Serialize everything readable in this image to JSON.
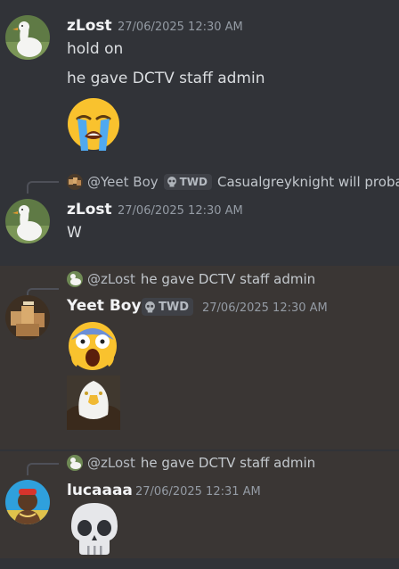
{
  "messages": [
    {
      "author": "zLost",
      "timestamp": "27/06/2025 12:30 AM",
      "lines": [
        "hold on",
        "he gave DCTV staff admin"
      ],
      "emoji": "loudly-crying-face"
    },
    {
      "reply": {
        "user": "@Yeet Boy",
        "tag": "TWD",
        "text": "Casualgreyknight will proba"
      },
      "author": "zLost",
      "timestamp": "27/06/2025 12:30 AM",
      "text": "W"
    },
    {
      "reply": {
        "user": "@zLost",
        "text": "he gave DCTV staff admin"
      },
      "author": "Yeet Boy",
      "tag": "TWD",
      "timestamp": "27/06/2025 12:30 AM",
      "emoji": "screaming-face",
      "image": "bald-eagle"
    },
    {
      "reply": {
        "user": "@zLost",
        "text": "he gave DCTV staff admin"
      },
      "author": "lucaaaa",
      "timestamp": "27/06/2025 12:31 AM",
      "emoji": "skull"
    }
  ],
  "colors": {
    "background": "#313338",
    "highlight": "#3a3634",
    "timestamp": "#949ba4",
    "tag_bg": "#3f4147"
  }
}
